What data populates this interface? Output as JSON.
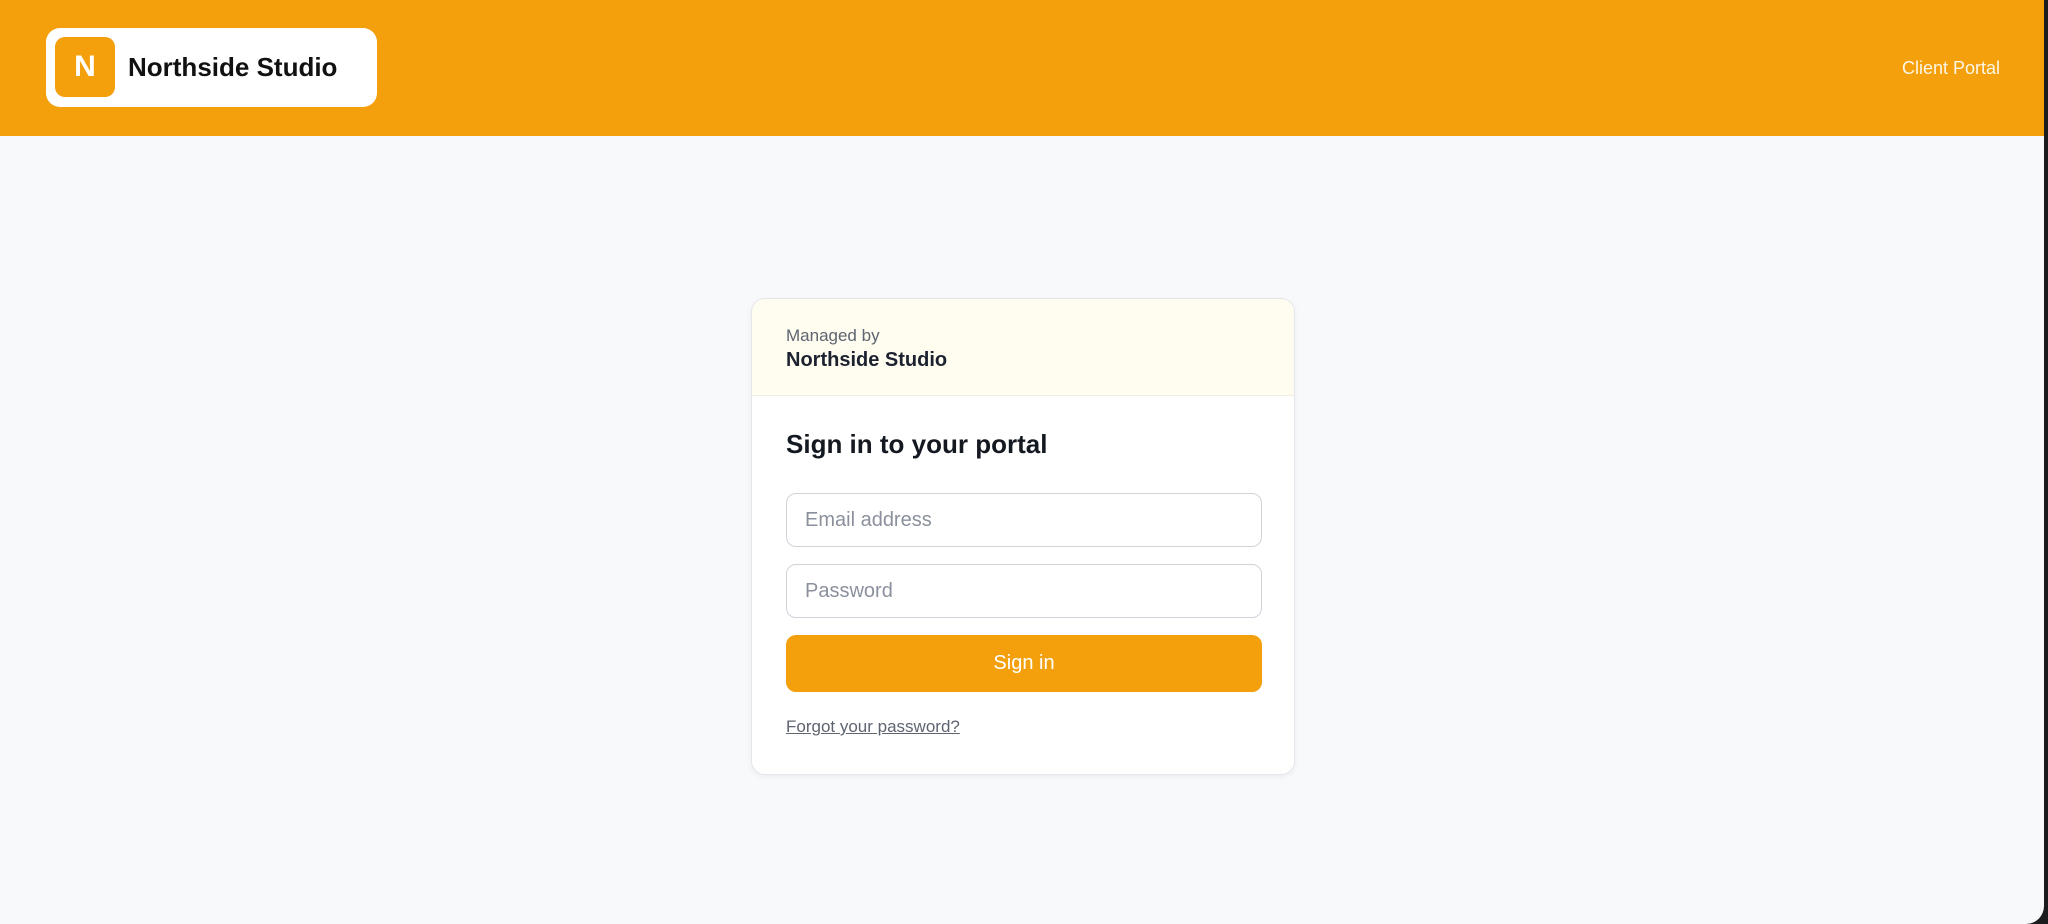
{
  "header": {
    "brand_initial": "N",
    "brand_name": "Northside Studio",
    "portal_link": "Client Portal"
  },
  "card": {
    "managed_label": "Managed by",
    "managed_name": "Northside Studio",
    "title": "Sign in to your portal",
    "email_placeholder": "Email address",
    "email_value": "",
    "password_placeholder": "Password",
    "password_value": "",
    "signin_label": "Sign in",
    "forgot_label": "Forgot your password?"
  },
  "colors": {
    "accent": "#f4a00d",
    "background": "#f7f9fb",
    "card_header": "#fffcf0"
  }
}
